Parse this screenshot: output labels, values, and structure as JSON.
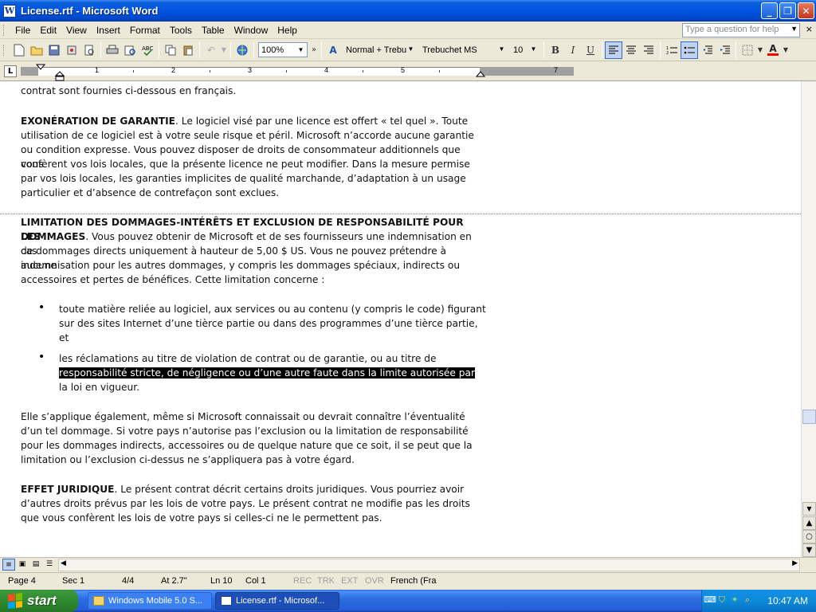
{
  "window": {
    "title": "License.rtf - Microsoft Word",
    "app_icon": "W",
    "buttons": {
      "minimize": "_",
      "restore": "❐",
      "close": "✕"
    }
  },
  "menubar": {
    "items": [
      "File",
      "Edit",
      "View",
      "Insert",
      "Format",
      "Tools",
      "Table",
      "Window",
      "Help"
    ],
    "help_placeholder": "Type a question for help",
    "close_glyph": "×"
  },
  "toolbar": {
    "zoom": "100%",
    "style": "Normal + Trebu",
    "font": "Trebuchet MS",
    "font_size": "10",
    "bold": "B",
    "italic": "I",
    "underline": "U",
    "font_color_letter": "A",
    "font_color": "#ff0000"
  },
  "ruler": {
    "tab_selector": "L",
    "numbers": [
      "1",
      "2",
      "3",
      "4",
      "5",
      "7"
    ]
  },
  "document": {
    "line0": "contrat sont fournies ci-dessous en français.",
    "p1_head": "EXONÉRATION DE GARANTIE",
    "p1_l1": ". Le logiciel visé par une licence est offert « tel quel ». Toute",
    "p1_l2": "utilisation de ce logiciel est à votre seule risque et péril. Microsoft n’accorde aucune garantie",
    "p1_l3": "ou condition expresse. Vous pouvez disposer de droits de consommateur additionnels que vous",
    "p1_l4": "confèrent vos lois locales, que la présente licence ne peut modifier. Dans la mesure permise",
    "p1_l5": "par vos lois locales, les garanties implicites de qualité marchande, d’adaptation à un usage",
    "p1_l6": "particulier et d’absence de contrefaçon sont exclues.",
    "p2_head1": "LIMITATION DES DOMMAGES-INTÉRÊTS ET EXCLUSION DE RESPONSABILITÉ POUR LES",
    "p2_head2": "DOMMAGES",
    "p2_l1": ".  Vous pouvez obtenir de Microsoft et de ses fournisseurs une indemnisation en cas",
    "p2_l2": "de dommages directs uniquement à hauteur de 5,00 $ US. Vous ne pouvez prétendre à aucune",
    "p2_l3": "indemnisation pour les autres dommages, y compris les dommages spéciaux, indirects ou",
    "p2_l4": "accessoires et pertes de bénéfices.  Cette limitation concerne :",
    "b1_l1": "toute matière reliée au logiciel, aux services ou au contenu (y compris le code) figurant",
    "b1_l2": "sur des sites Internet d’une tièrce partie ou dans des programmes d’une tièrce partie,",
    "b1_l3": "et",
    "b2_l1": "les réclamations au titre de violation de contrat ou de garantie, ou au titre de",
    "b2_l2": "responsabilité stricte, de négligence ou d’une autre faute dans la limite autorisée par",
    "b2_l3": "la loi en vigueur.",
    "p3_l1": "Elle s’applique également, même si Microsoft connaissait ou devrait connaître l’éventualité",
    "p3_l2": "d’un tel dommage.  Si votre pays n’autorise pas l’exclusion ou la limitation de responsabilité",
    "p3_l3": "pour les dommages indirects, accessoires ou de quelque nature que ce soit, il se peut que la",
    "p3_l4": "limitation ou l’exclusion ci-dessus ne s’appliquera pas à votre égard.",
    "p4_head": "EFFET JURIDIQUE",
    "p4_l1": ".  Le présent contrat décrit certains droits juridiques. Vous pourriez avoir",
    "p4_l2": "d’autres droits prévus par les lois de votre pays.  Le présent contrat ne modifie pas les droits",
    "p4_l3": "que vous confèrent les lois de votre pays si celles-ci ne le permettent pas.",
    "bullet": "•"
  },
  "statusbar": {
    "page": "Page 4",
    "sec": "Sec 1",
    "pages": "4/4",
    "at": "At 2.7\"",
    "ln": "Ln 10",
    "col": "Col 1",
    "rec": "REC",
    "trk": "TRK",
    "ext": "EXT",
    "ovr": "OVR",
    "language": "French (Fra"
  },
  "taskbar": {
    "start_label": "start",
    "items": [
      "Windows Mobile 5.0 S...",
      "License.rtf - Microsof..."
    ],
    "clock": "10:47 AM"
  }
}
